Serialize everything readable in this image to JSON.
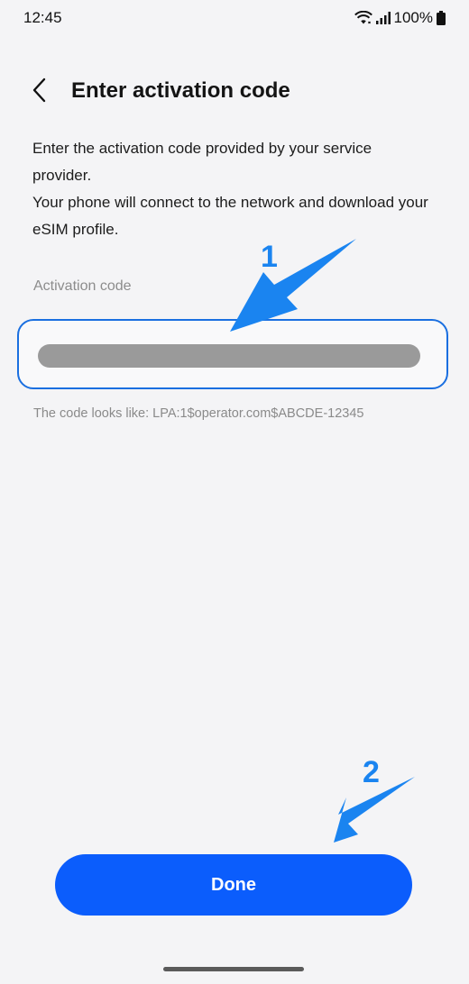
{
  "status_bar": {
    "time": "12:45",
    "battery": "100%",
    "icons": [
      "wifi-icon",
      "signal-icon",
      "battery-icon"
    ]
  },
  "header": {
    "title": "Enter activation code",
    "back_icon": "chevron-left-icon"
  },
  "description": {
    "line1": "Enter the activation code provided by your service provider.",
    "line2": "Your phone will connect to the network and download your eSIM profile."
  },
  "activation_field": {
    "label": "Activation code",
    "value": "",
    "hint": "The code looks like: LPA:1$operator.com$ABCDE-12345"
  },
  "done_button": {
    "label": "Done"
  },
  "annotations": {
    "step1": "1",
    "step2": "2",
    "color": "#1a84f0"
  },
  "colors": {
    "accent": "#0b5dfc",
    "field_border": "#1a6fe0",
    "background": "#f4f4f6"
  }
}
